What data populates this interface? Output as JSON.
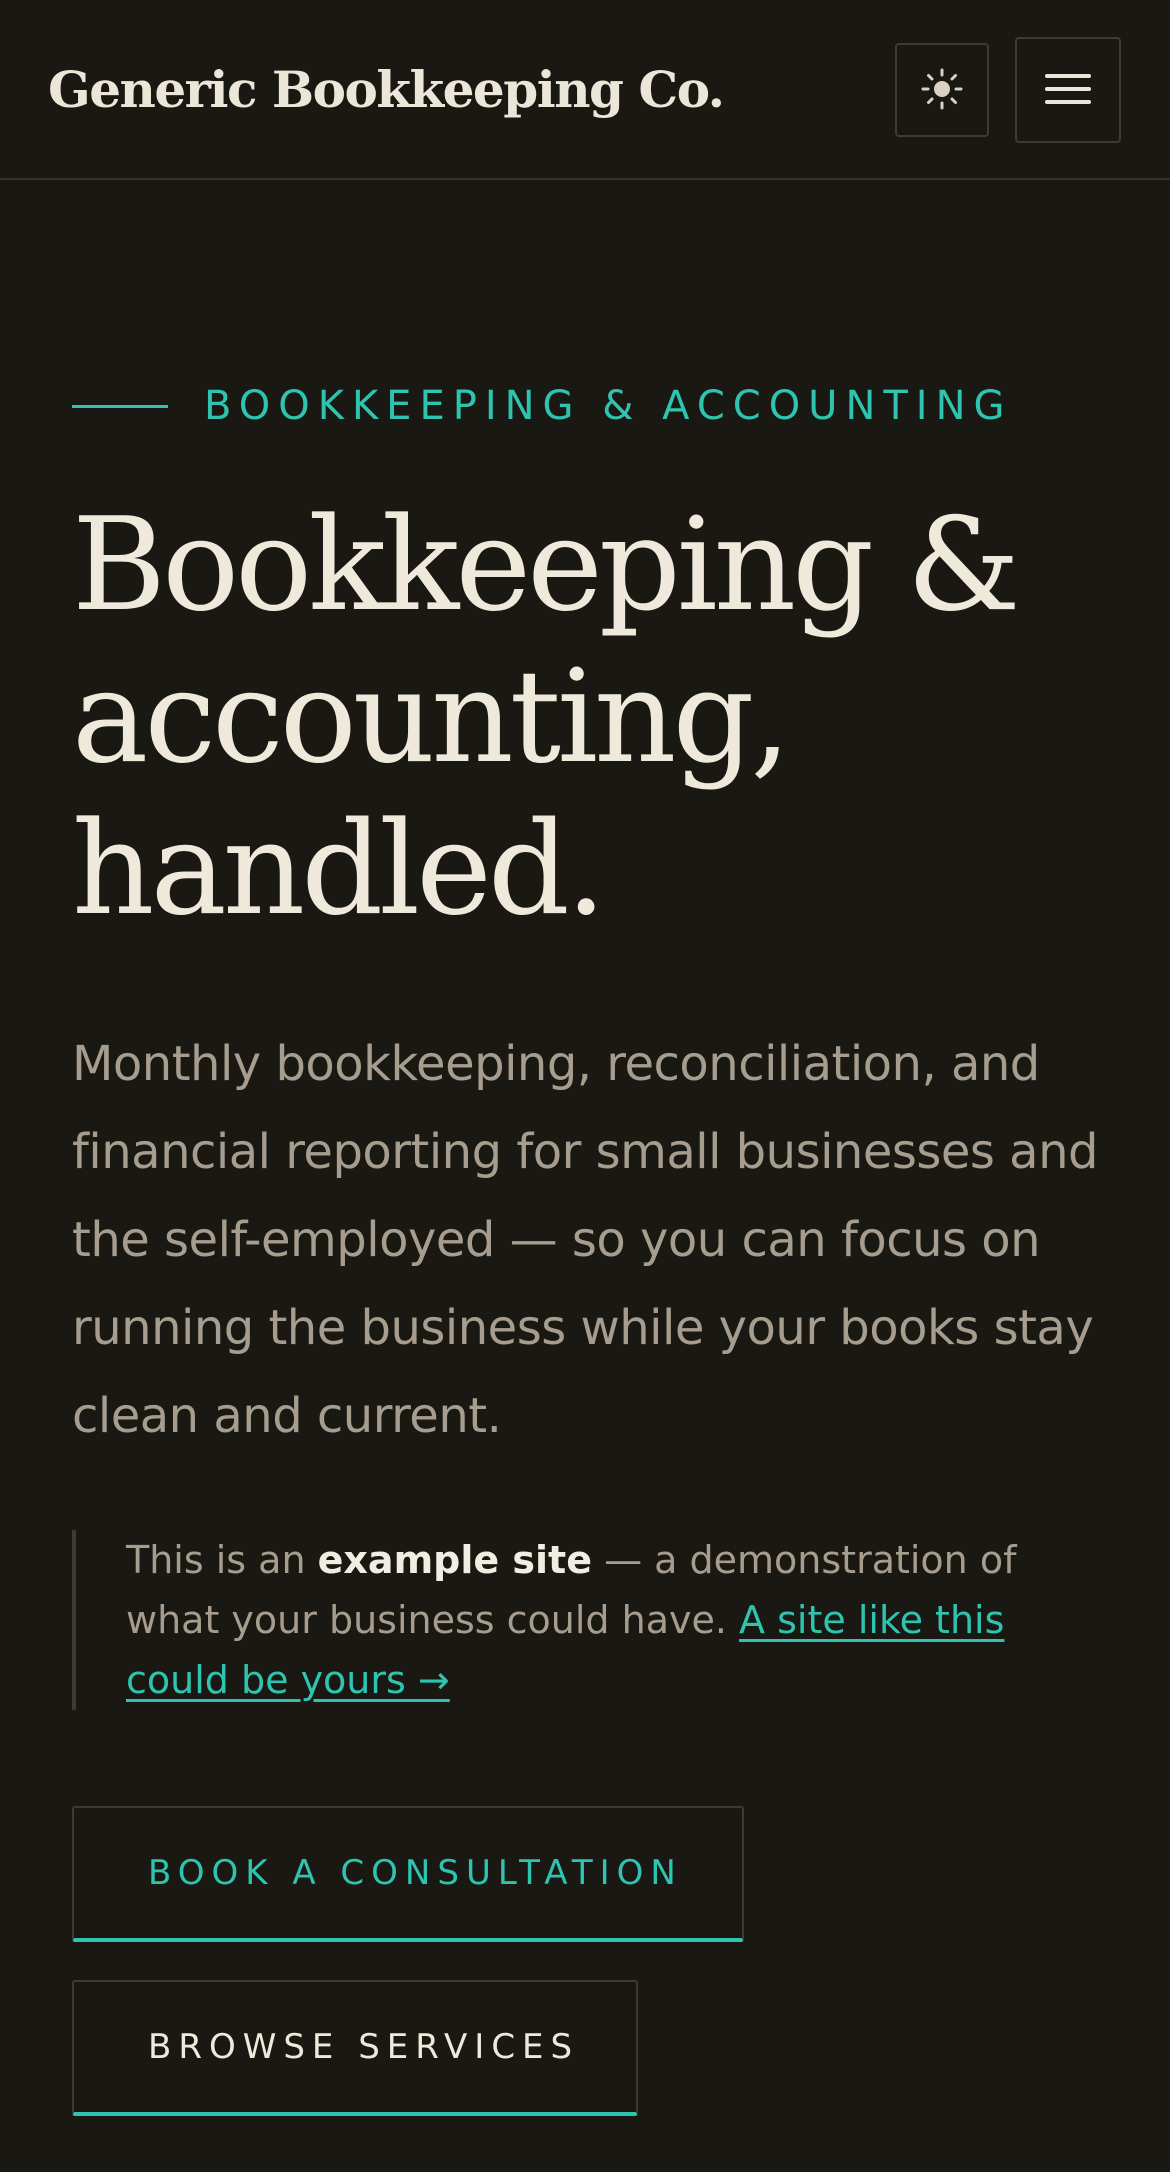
{
  "header": {
    "brand": "Generic Bookkeeping Co.",
    "theme_toggle_icon": "sun-icon",
    "menu_icon": "hamburger-menu-icon"
  },
  "hero": {
    "eyebrow": "BOOKKEEPING & ACCOUNTING",
    "headline_line1": "Bookkeeping &",
    "headline_line2": "accounting,",
    "headline_line3": "handled.",
    "lede": "Monthly bookkeeping, reconciliation, and financial reporting for small businesses and the self-employed — so you can focus on running the business while your books stay clean and current."
  },
  "notice": {
    "prefix": "This is an",
    "strong": "example site",
    "middle": "— a demonstration of what your business could have.",
    "link": "A site like this could be yours →"
  },
  "cta": {
    "primary": "BOOK A CONSULTATION",
    "secondary": "BROWSE SERVICES"
  },
  "colors": {
    "background": "#1a1813",
    "accent": "#2ec4b0",
    "text": "#efe9dc",
    "muted": "#a69d8e"
  }
}
